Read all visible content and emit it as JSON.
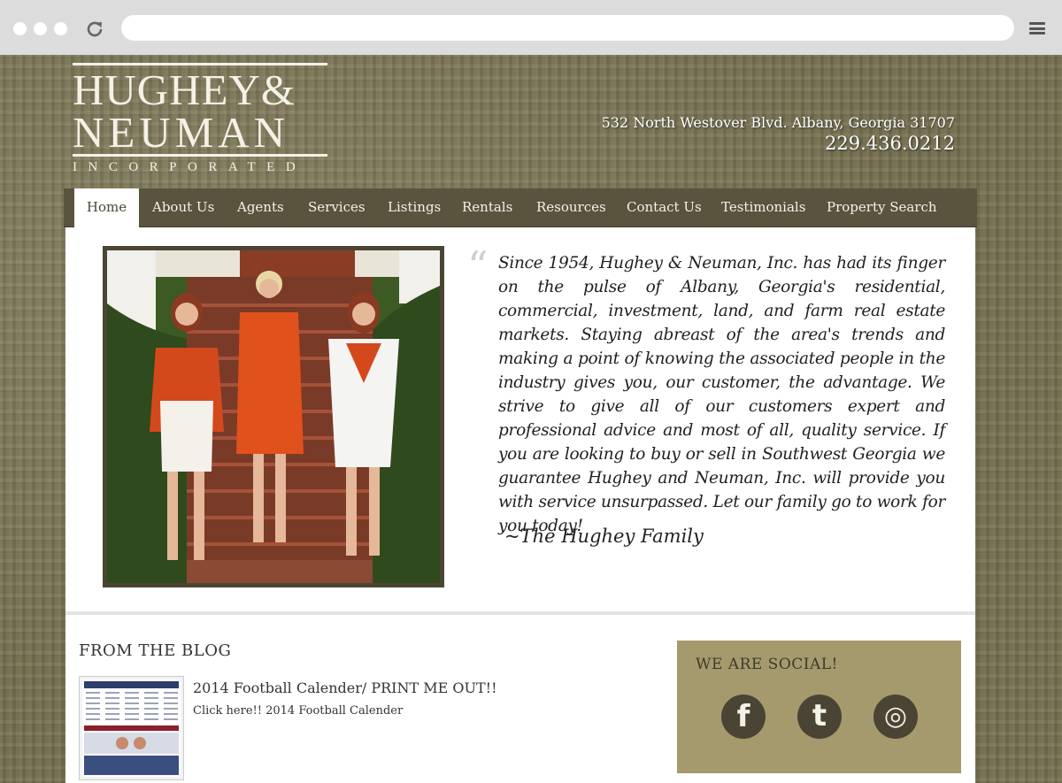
{
  "logo": {
    "line1": "HUGHEY&",
    "line2": "NEUMAN",
    "sub": "INCORPORATED"
  },
  "header": {
    "address": "532 North Westover Blvd. Albany, Georgia 31707",
    "phone": "229.436.0212"
  },
  "nav": {
    "items": [
      {
        "label": "Home",
        "active": true
      },
      {
        "label": "About Us"
      },
      {
        "label": "Agents"
      },
      {
        "label": "Services"
      },
      {
        "label": "Listings"
      },
      {
        "label": "Rentals"
      },
      {
        "label": "Resources"
      },
      {
        "label": "Contact Us"
      },
      {
        "label": "Testimonials"
      },
      {
        "label": "Property Search"
      }
    ]
  },
  "hero": {
    "quote_mark": "“",
    "quote": "Since 1954, Hughey & Neuman, Inc. has had its finger on the pulse of Albany, Georgia's residential, commercial, investment, land, and farm real estate markets. Staying abreast of the area's trends and making a point of knowing the associated people in the industry gives you, our customer, the advantage. We strive to give all of our customers expert and professional advice and most of all, quality service. If you are looking to buy or sell in Southwest Georgia we guarantee Hughey and Neuman, Inc. will provide you with service unsurpassed. Let our family go to work for you today!",
    "signature": "~The Hughey Family"
  },
  "blog": {
    "heading": "FROM THE BLOG",
    "post_title": "2014 Football Calender/ PRINT ME OUT!!",
    "post_link": "Click here!! 2014 Football Calender"
  },
  "social": {
    "heading": "WE ARE SOCIAL!",
    "icons": [
      {
        "name": "facebook-icon",
        "glyph": "f"
      },
      {
        "name": "twitter-icon",
        "glyph": "t"
      },
      {
        "name": "instagram-icon",
        "glyph": "◎"
      }
    ]
  },
  "colors": {
    "nav_bg": "#5a533d",
    "social_bg": "#a49a6e",
    "page_bg": "#7d7655"
  }
}
